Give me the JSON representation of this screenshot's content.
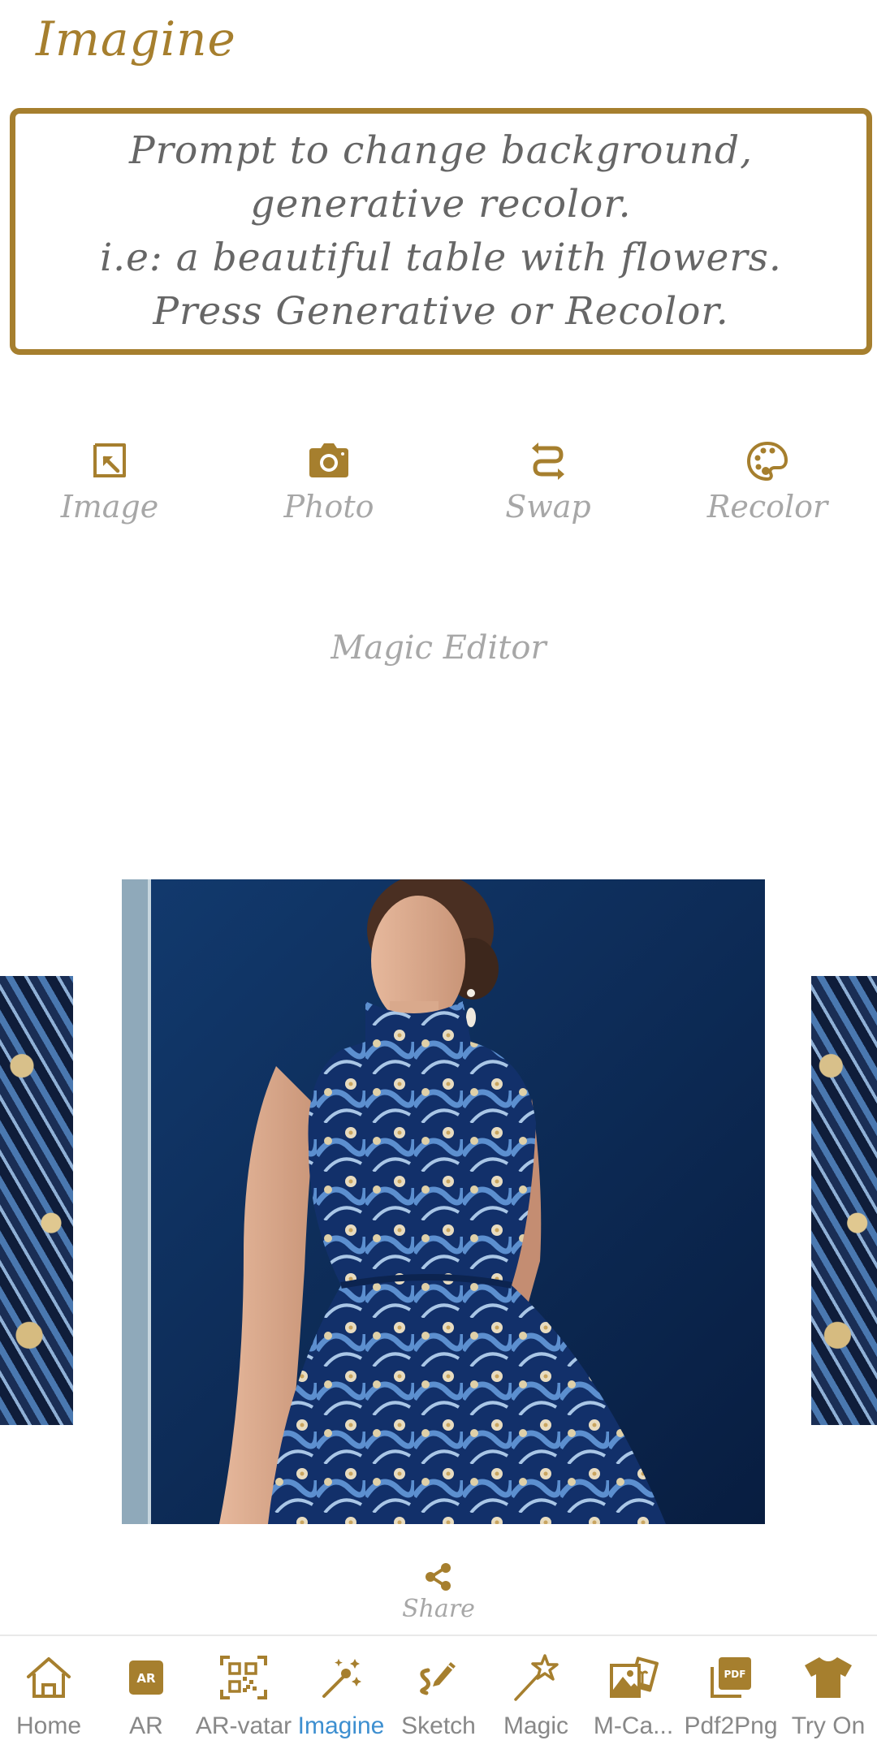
{
  "app": {
    "title": "Imagine"
  },
  "prompt": {
    "placeholder": "Prompt to change background, generative recolor.\ni.e: a beautiful table with flowers.\nPress Generative or Recolor.",
    "value": ""
  },
  "actions": [
    {
      "id": "image",
      "label": "Image",
      "icon": "import-image-icon"
    },
    {
      "id": "photo",
      "label": "Photo",
      "icon": "camera-icon"
    },
    {
      "id": "swap",
      "label": "Swap",
      "icon": "swap-arrows-icon"
    },
    {
      "id": "recolor",
      "label": "Recolor",
      "icon": "palette-icon"
    }
  ],
  "magic_editor": {
    "label": "Magic Editor"
  },
  "carousel": {
    "slides": [
      {
        "id": "prev",
        "description": "blue floral pattern fabric"
      },
      {
        "id": "current",
        "description": "woman in blue floral embroidered sleeveless dress against navy background"
      },
      {
        "id": "next",
        "description": "blue floral pattern fabric with golden flowers"
      }
    ]
  },
  "share": {
    "label": "Share",
    "icon": "share-icon"
  },
  "bottom_nav": {
    "active": "Imagine",
    "items": [
      {
        "label": "Home",
        "icon": "home-icon"
      },
      {
        "label": "AR",
        "icon": "ar-badge-icon"
      },
      {
        "label": "AR-vatar",
        "icon": "qr-scan-icon"
      },
      {
        "label": "Imagine",
        "icon": "magic-wand-sparkle-icon"
      },
      {
        "label": "Sketch",
        "icon": "sketch-pen-icon"
      },
      {
        "label": "Magic",
        "icon": "star-wand-icon"
      },
      {
        "label": "M-Ca...",
        "icon": "photo-collage-icon"
      },
      {
        "label": "Pdf2Png",
        "icon": "pdf-icon"
      },
      {
        "label": "Try On",
        "icon": "tshirt-icon"
      }
    ]
  },
  "colors": {
    "accent": "#a67f2e",
    "muted_text": "#a7a7a7",
    "active_nav": "#3d8fd0"
  }
}
